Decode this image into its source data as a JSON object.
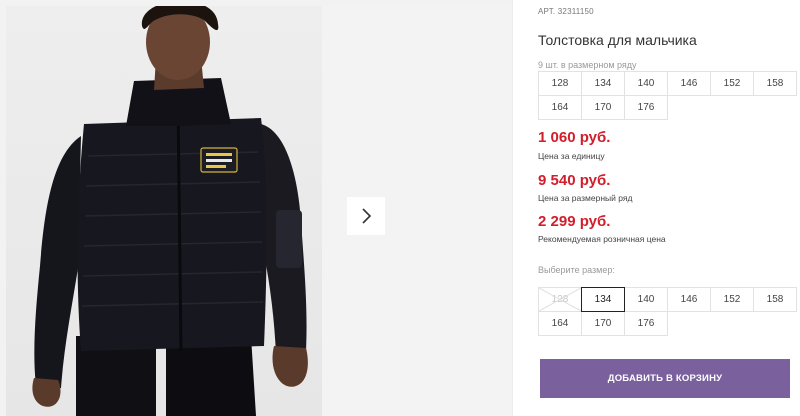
{
  "product": {
    "sku_prefix": "АРТ.",
    "sku": "32311150",
    "title": "Толстовка для мальчика",
    "image_alt_icon": "product-photo"
  },
  "pack": {
    "caption": "9 шт. в размерном ряду",
    "sizes": [
      "128",
      "134",
      "140",
      "146",
      "152",
      "158",
      "164",
      "170",
      "176"
    ]
  },
  "prices": {
    "unit_price": "1 060 руб.",
    "unit_label": "Цена за единицу",
    "pack_price": "9 540 руб.",
    "pack_label": "Цена за размерный ряд",
    "retail_price": "2 299 руб.",
    "retail_label": "Рекомендуемая розничная цена"
  },
  "size_select": {
    "label": "Выберите размер:",
    "options": [
      {
        "size": "128",
        "state": "unavailable"
      },
      {
        "size": "134",
        "state": "selected"
      },
      {
        "size": "140",
        "state": "available"
      },
      {
        "size": "146",
        "state": "available"
      },
      {
        "size": "152",
        "state": "available"
      },
      {
        "size": "158",
        "state": "available"
      },
      {
        "size": "164",
        "state": "available"
      },
      {
        "size": "170",
        "state": "available"
      },
      {
        "size": "176",
        "state": "available"
      }
    ]
  },
  "cart": {
    "button_label": "ДОБАВИТЬ В КОРЗИНУ"
  },
  "gallery": {
    "next_icon": "chevron-right-icon"
  },
  "colors": {
    "price_red": "#d21e2b",
    "cart_purple": "#7a619e"
  }
}
